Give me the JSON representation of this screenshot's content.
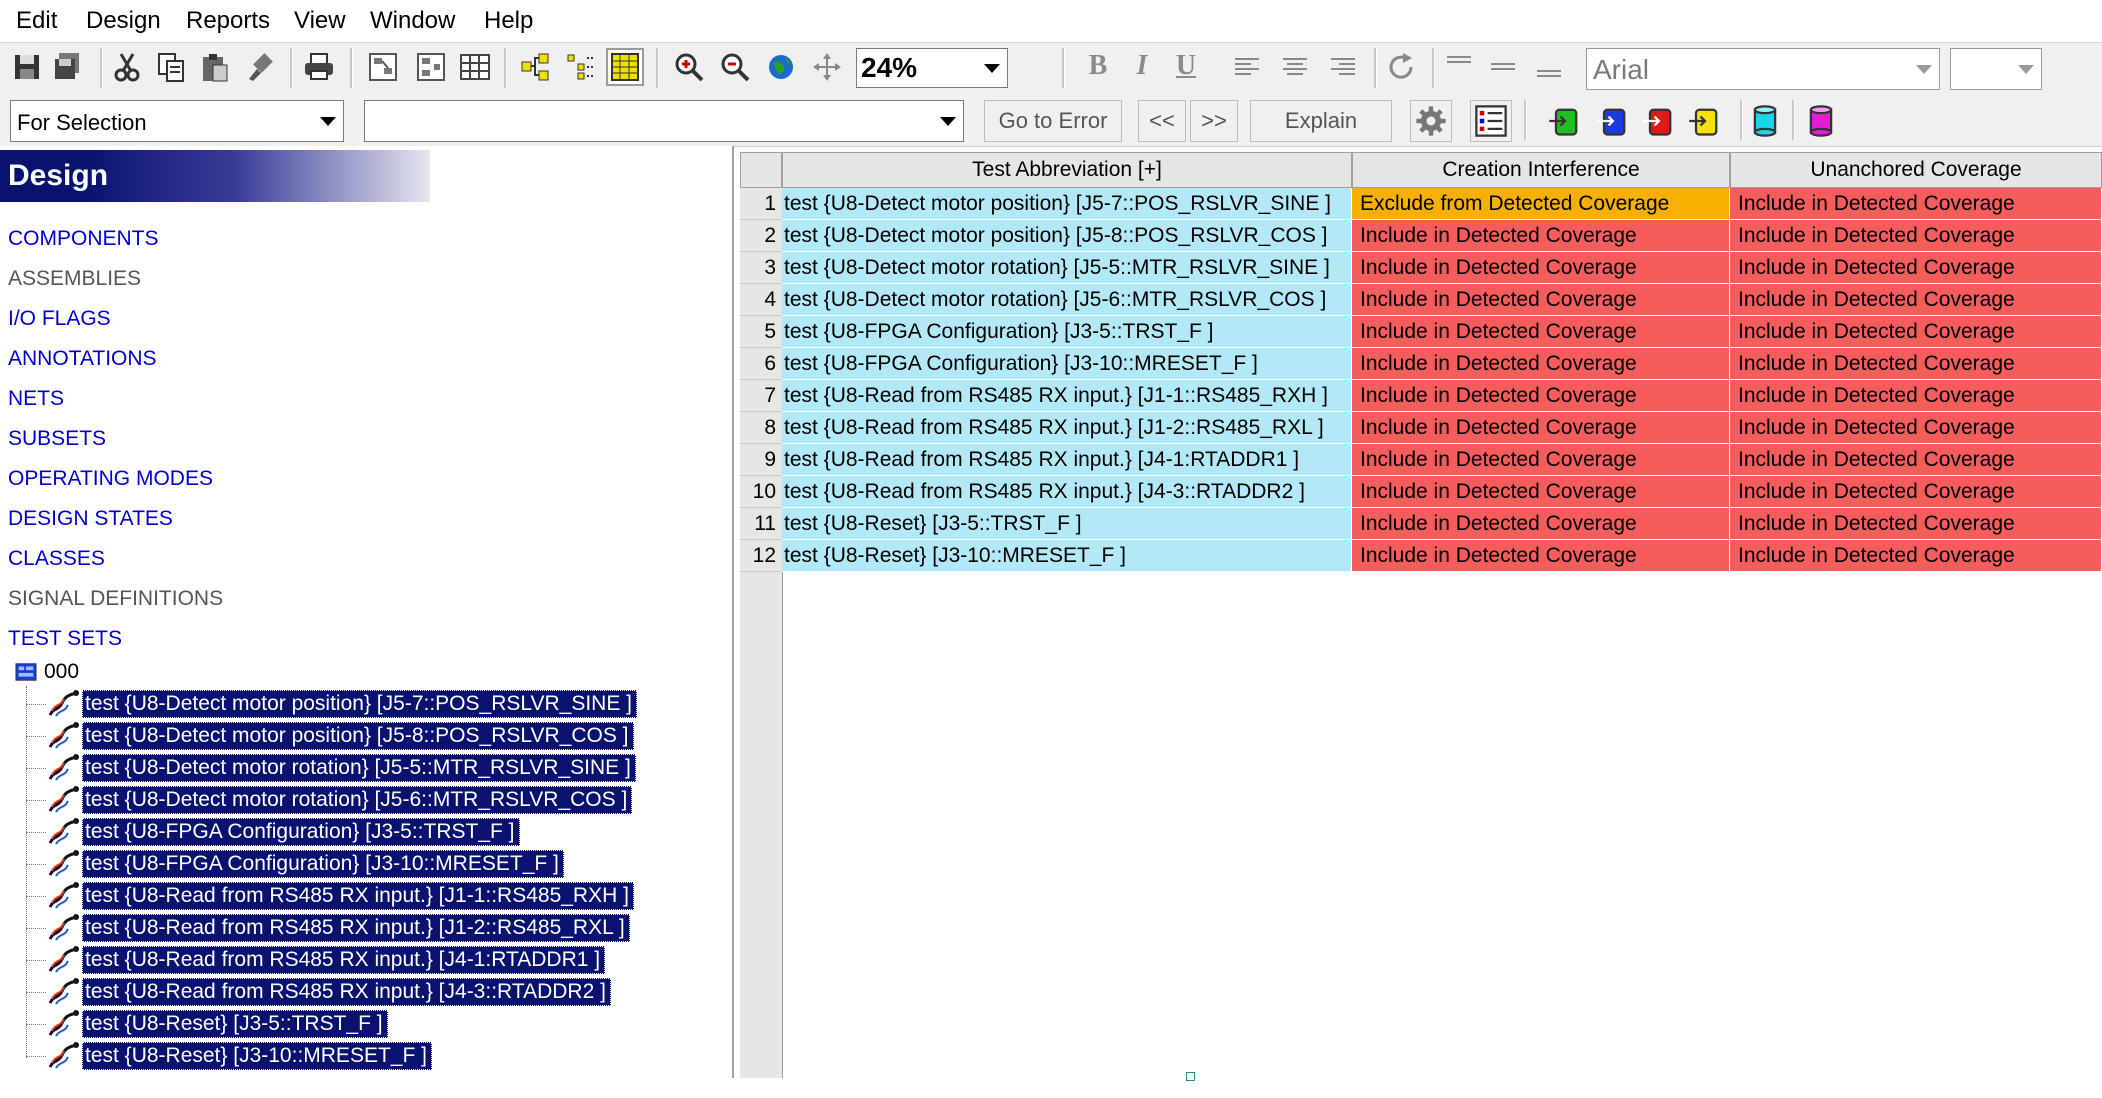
{
  "menubar": {
    "items": [
      "Edit",
      "Design",
      "Reports",
      "View",
      "Window",
      "Help"
    ]
  },
  "toolbar": {
    "zoom_value": "24%",
    "font_name": "Arial",
    "format_bold": "B",
    "format_italic": "I",
    "format_underline": "U"
  },
  "toolbar2": {
    "scope_value": "For Selection",
    "filter_value": "",
    "go_to_error_label": "Go to Error",
    "prev_label": "<<",
    "next_label": ">>",
    "explain_label": "Explain"
  },
  "tree": {
    "header": "Design",
    "categories": [
      "COMPONENTS",
      "ASSEMBLIES",
      "I/O FLAGS",
      "ANNOTATIONS",
      "NETS",
      "SUBSETS",
      "OPERATING MODES",
      "DESIGN STATES",
      "CLASSES",
      "SIGNAL DEFINITIONS",
      "TEST SETS"
    ],
    "test_set_name": "000",
    "tests": [
      "test {U8-Detect motor position} [J5-7::POS_RSLVR_SINE ]",
      "test {U8-Detect motor position} [J5-8::POS_RSLVR_COS ]",
      "test {U8-Detect motor rotation} [J5-5::MTR_RSLVR_SINE ]",
      "test {U8-Detect motor rotation} [J5-6::MTR_RSLVR_COS ]",
      "test {U8-FPGA Configuration} [J3-5::TRST_F ]",
      "test {U8-FPGA Configuration} [J3-10::MRESET_F ]",
      "test {U8-Read from RS485 RX input.} [J1-1::RS485_RXH ]",
      "test {U8-Read from RS485 RX input.} [J1-2::RS485_RXL ]",
      "test {U8-Read from RS485 RX input.} [J4-1:RTADDR1 ]",
      "test {U8-Read from RS485 RX input.} [J4-3::RTADDR2 ]",
      "test {U8-Reset} [J3-5::TRST_F ]",
      "test {U8-Reset} [J3-10::MRESET_F ]"
    ]
  },
  "grid": {
    "columns": [
      "Test Abbreviation [+]",
      "Creation Interference",
      "Unanchored Coverage"
    ],
    "rows": [
      {
        "num": "1",
        "abbr": "test {U8-Detect motor position} [J5-7::POS_RSLVR_SINE ]",
        "creation": "Exclude from Detected Coverage",
        "unanchored": "Include in Detected Coverage"
      },
      {
        "num": "2",
        "abbr": "test {U8-Detect motor position} [J5-8::POS_RSLVR_COS ]",
        "creation": "Include in Detected Coverage",
        "unanchored": "Include in Detected Coverage"
      },
      {
        "num": "3",
        "abbr": "test {U8-Detect motor rotation} [J5-5::MTR_RSLVR_SINE ]",
        "creation": "Include in Detected Coverage",
        "unanchored": "Include in Detected Coverage"
      },
      {
        "num": "4",
        "abbr": "test {U8-Detect motor rotation} [J5-6::MTR_RSLVR_COS ]",
        "creation": "Include in Detected Coverage",
        "unanchored": "Include in Detected Coverage"
      },
      {
        "num": "5",
        "abbr": "test {U8-FPGA Configuration} [J3-5::TRST_F ]",
        "creation": "Include in Detected Coverage",
        "unanchored": "Include in Detected Coverage"
      },
      {
        "num": "6",
        "abbr": "test {U8-FPGA Configuration} [J3-10::MRESET_F ]",
        "creation": "Include in Detected Coverage",
        "unanchored": "Include in Detected Coverage"
      },
      {
        "num": "7",
        "abbr": "test {U8-Read from RS485 RX input.} [J1-1::RS485_RXH ]",
        "creation": "Include in Detected Coverage",
        "unanchored": "Include in Detected Coverage"
      },
      {
        "num": "8",
        "abbr": "test {U8-Read from RS485 RX input.} [J1-2::RS485_RXL ]",
        "creation": "Include in Detected Coverage",
        "unanchored": "Include in Detected Coverage"
      },
      {
        "num": "9",
        "abbr": "test {U8-Read from RS485 RX input.} [J4-1:RTADDR1 ]",
        "creation": "Include in Detected Coverage",
        "unanchored": "Include in Detected Coverage"
      },
      {
        "num": "10",
        "abbr": "test {U8-Read from RS485 RX input.} [J4-3::RTADDR2 ]",
        "creation": "Include in Detected Coverage",
        "unanchored": "Include in Detected Coverage"
      },
      {
        "num": "11",
        "abbr": "test {U8-Reset} [J3-5::TRST_F ]",
        "creation": "Include in Detected Coverage",
        "unanchored": "Include in Detected Coverage"
      },
      {
        "num": "12",
        "abbr": "test {U8-Reset} [J3-10::MRESET_F ]",
        "creation": "Include in Detected Coverage",
        "unanchored": "Include in Detected Coverage"
      }
    ]
  },
  "colors": {
    "include": "#f55d5d",
    "exclude": "#f7b000",
    "abbr_bg": "#b3e8f7",
    "selection": "#0a1270",
    "link_blue": "#0000cc"
  }
}
